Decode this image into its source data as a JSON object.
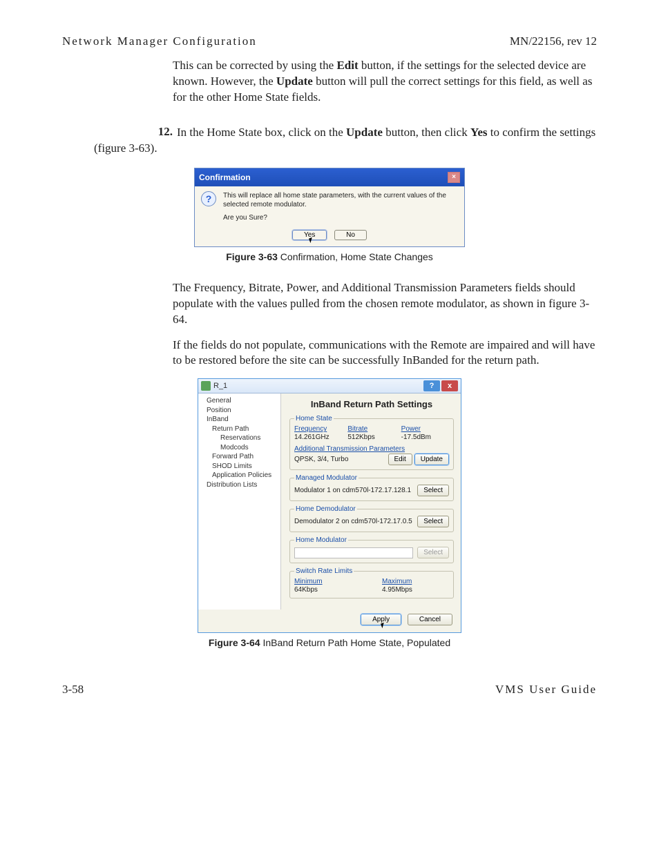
{
  "header": {
    "left": "Network Manager Configuration",
    "right": "MN/22156, rev 12"
  },
  "para1_pre": "This can be corrected by using the ",
  "para1_b1": "Edit",
  "para1_mid1": " button, if the settings for the selected device are known. However, the ",
  "para1_b2": "Update",
  "para1_post": " button will pull the correct settings for this field, as well as for the other Home State fields.",
  "step": {
    "num": "12.",
    "s1": " In the Home State box, click on the ",
    "b1": "Update",
    "s2": " button, then click ",
    "b2": "Yes",
    "s3": " to confirm the settings (figure 3-63)."
  },
  "confirm": {
    "title": "Confirmation",
    "line1": "This will replace all home state parameters, with the current values of the selected remote modulator.",
    "line2": "Are you Sure?",
    "yes": "Yes",
    "no": "No"
  },
  "fig63": {
    "b": "Figure 3-63",
    "t": "  Confirmation, Home State Changes"
  },
  "para2": "The Frequency, Bitrate, Power, and Additional Transmission Parameters fields should populate with the values pulled from the chosen remote modulator, as shown in figure 3-64.",
  "para3": "If the fields do not populate, communications with the Remote are impaired and will have to be restored before the site can be successfully InBanded for the return path.",
  "inband": {
    "title": "R_1",
    "tree": {
      "general": "General",
      "position": "Position",
      "inband": "InBand",
      "returnpath": "Return Path",
      "reservations": "Reservations",
      "modcods": "Modcods",
      "forwardpath": "Forward Path",
      "shod": "SHOD Limits",
      "app": "Application Policies",
      "dist": "Distribution Lists"
    },
    "panel_title": "InBand Return Path Settings",
    "home_state": "Home State",
    "freq_lbl": "Frequency",
    "freq_val": "14.261GHz",
    "br_lbl": "Bitrate",
    "br_val": "512Kbps",
    "pw_lbl": "Power",
    "pw_val": "-17.5dBm",
    "atp_lbl": "Additional Transmission Parameters",
    "atp_val": "QPSK, 3/4, Turbo",
    "edit": "Edit",
    "update": "Update",
    "mm_legend": "Managed Modulator",
    "mm_val": "Modulator 1 on cdm570l-172.17.128.1",
    "select": "Select",
    "hd_legend": "Home Demodulator",
    "hd_val": "Demodulator 2 on cdm570l-172.17.0.5",
    "hm_legend": "Home Modulator",
    "srl_legend": "Switch Rate Limits",
    "min_lbl": "Minimum",
    "min_val": "64Kbps",
    "max_lbl": "Maximum",
    "max_val": "4.95Mbps",
    "apply": "Apply",
    "cancel": "Cancel"
  },
  "fig64": {
    "b": "Figure 3-64",
    "t": "  InBand Return Path Home State, Populated"
  },
  "footer": {
    "left": "3-58",
    "right": "VMS User Guide"
  }
}
